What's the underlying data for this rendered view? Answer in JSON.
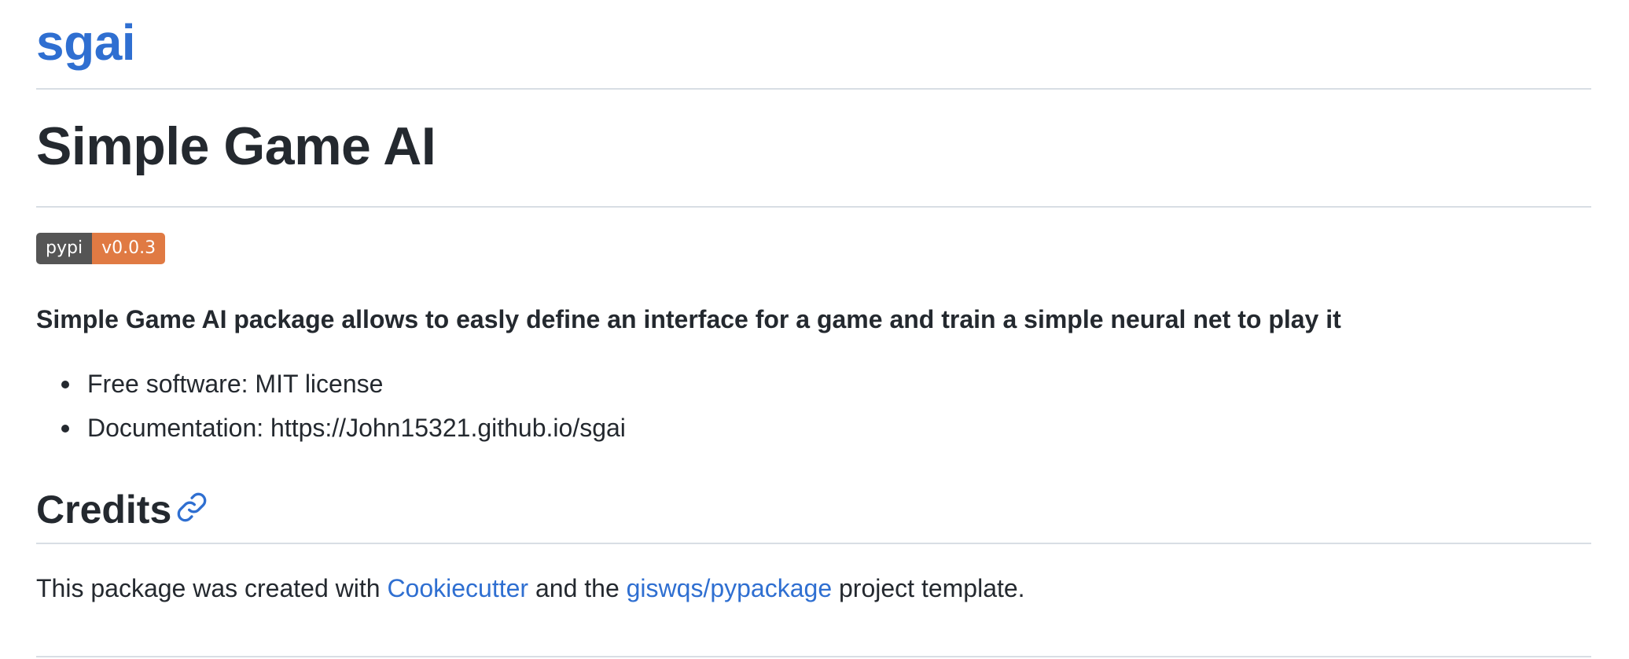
{
  "header": {
    "site_title": "sgai"
  },
  "main": {
    "title": "Simple Game AI",
    "badge": {
      "label": "pypi",
      "value": "v0.0.3",
      "label_color": "#555555",
      "value_color": "#e07a43"
    },
    "lead": "Simple Game AI package allows to easly define an interface for a game and train a simple neural net to play it",
    "bullets": [
      "Free software: MIT license",
      "Documentation: https://John15321.github.io/sgai"
    ],
    "credits": {
      "heading": "Credits",
      "anchor_icon": "link-icon",
      "text_before": "This package was created with ",
      "link1": "Cookiecutter",
      "text_middle": " and the ",
      "link2": "giswqs/pypackage",
      "text_after": " project template."
    }
  },
  "colors": {
    "link": "#2f6fd1",
    "text": "#24292f",
    "rule": "#d8dee4"
  }
}
